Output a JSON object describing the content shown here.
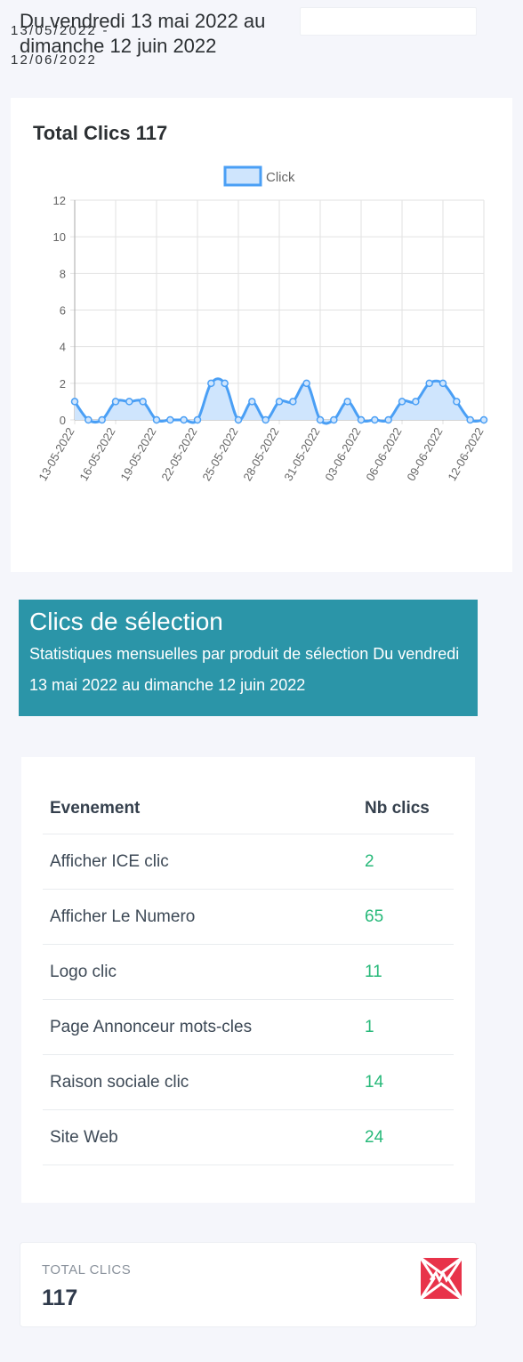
{
  "header": {
    "period_title": "Du vendredi 13 mai 2022 au dimanche 12 juin 2022",
    "date_range": "13/05/2022 - 12/06/2022"
  },
  "chart_card": {
    "title": "Total Clics 117"
  },
  "chart_data": {
    "type": "area",
    "title": "Total Clics 117",
    "legend": "top",
    "grid": true,
    "ylim": [
      0,
      12
    ],
    "yticks": [
      0,
      2,
      4,
      6,
      8,
      10,
      12
    ],
    "x": [
      "13-05-2022",
      "14-05-2022",
      "15-05-2022",
      "16-05-2022",
      "17-05-2022",
      "18-05-2022",
      "19-05-2022",
      "20-05-2022",
      "21-05-2022",
      "22-05-2022",
      "23-05-2022",
      "24-05-2022",
      "25-05-2022",
      "26-05-2022",
      "27-05-2022",
      "28-05-2022",
      "29-05-2022",
      "30-05-2022",
      "31-05-2022",
      "01-06-2022",
      "02-06-2022",
      "03-06-2022",
      "04-06-2022",
      "05-06-2022",
      "06-06-2022",
      "07-06-2022",
      "08-06-2022",
      "09-06-2022",
      "10-06-2022",
      "11-06-2022",
      "12-06-2022"
    ],
    "xtick_labels": [
      "13-05-2022",
      "16-05-2022",
      "19-05-2022",
      "22-05-2022",
      "25-05-2022",
      "28-05-2022",
      "31-05-2022",
      "03-06-2022",
      "06-06-2022",
      "09-06-2022",
      "12-06-2022"
    ],
    "series": [
      {
        "name": "Click",
        "color": "#4a9ff5",
        "fill": "#cfe5fd",
        "values": [
          1,
          0,
          0,
          1,
          1,
          1,
          0,
          0,
          0,
          0,
          2,
          2,
          0,
          1,
          0,
          1,
          1,
          2,
          0,
          0,
          1,
          0,
          0,
          0,
          1,
          1,
          2,
          2,
          1,
          0,
          0
        ]
      }
    ]
  },
  "banner": {
    "title": "Clics de sélection",
    "subtitle": "Statistiques mensuelles par produit de sélection Du vendredi 13 mai 2022 au dimanche 12 juin 2022"
  },
  "events_table": {
    "headers": [
      "Evenement",
      "Nb clics"
    ],
    "rows": [
      [
        "Afficher ICE clic",
        "2"
      ],
      [
        "Afficher Le Numero",
        "65"
      ],
      [
        "Logo clic",
        "11"
      ],
      [
        "Page Annonceur mots-cles",
        "1"
      ],
      [
        "Raison sociale clic",
        "14"
      ],
      [
        "Site Web",
        "24"
      ]
    ]
  },
  "total": {
    "label": "TOTAL CLICS",
    "value": "117",
    "icon": "brand-logo-icon",
    "accent": "#e8334a"
  }
}
